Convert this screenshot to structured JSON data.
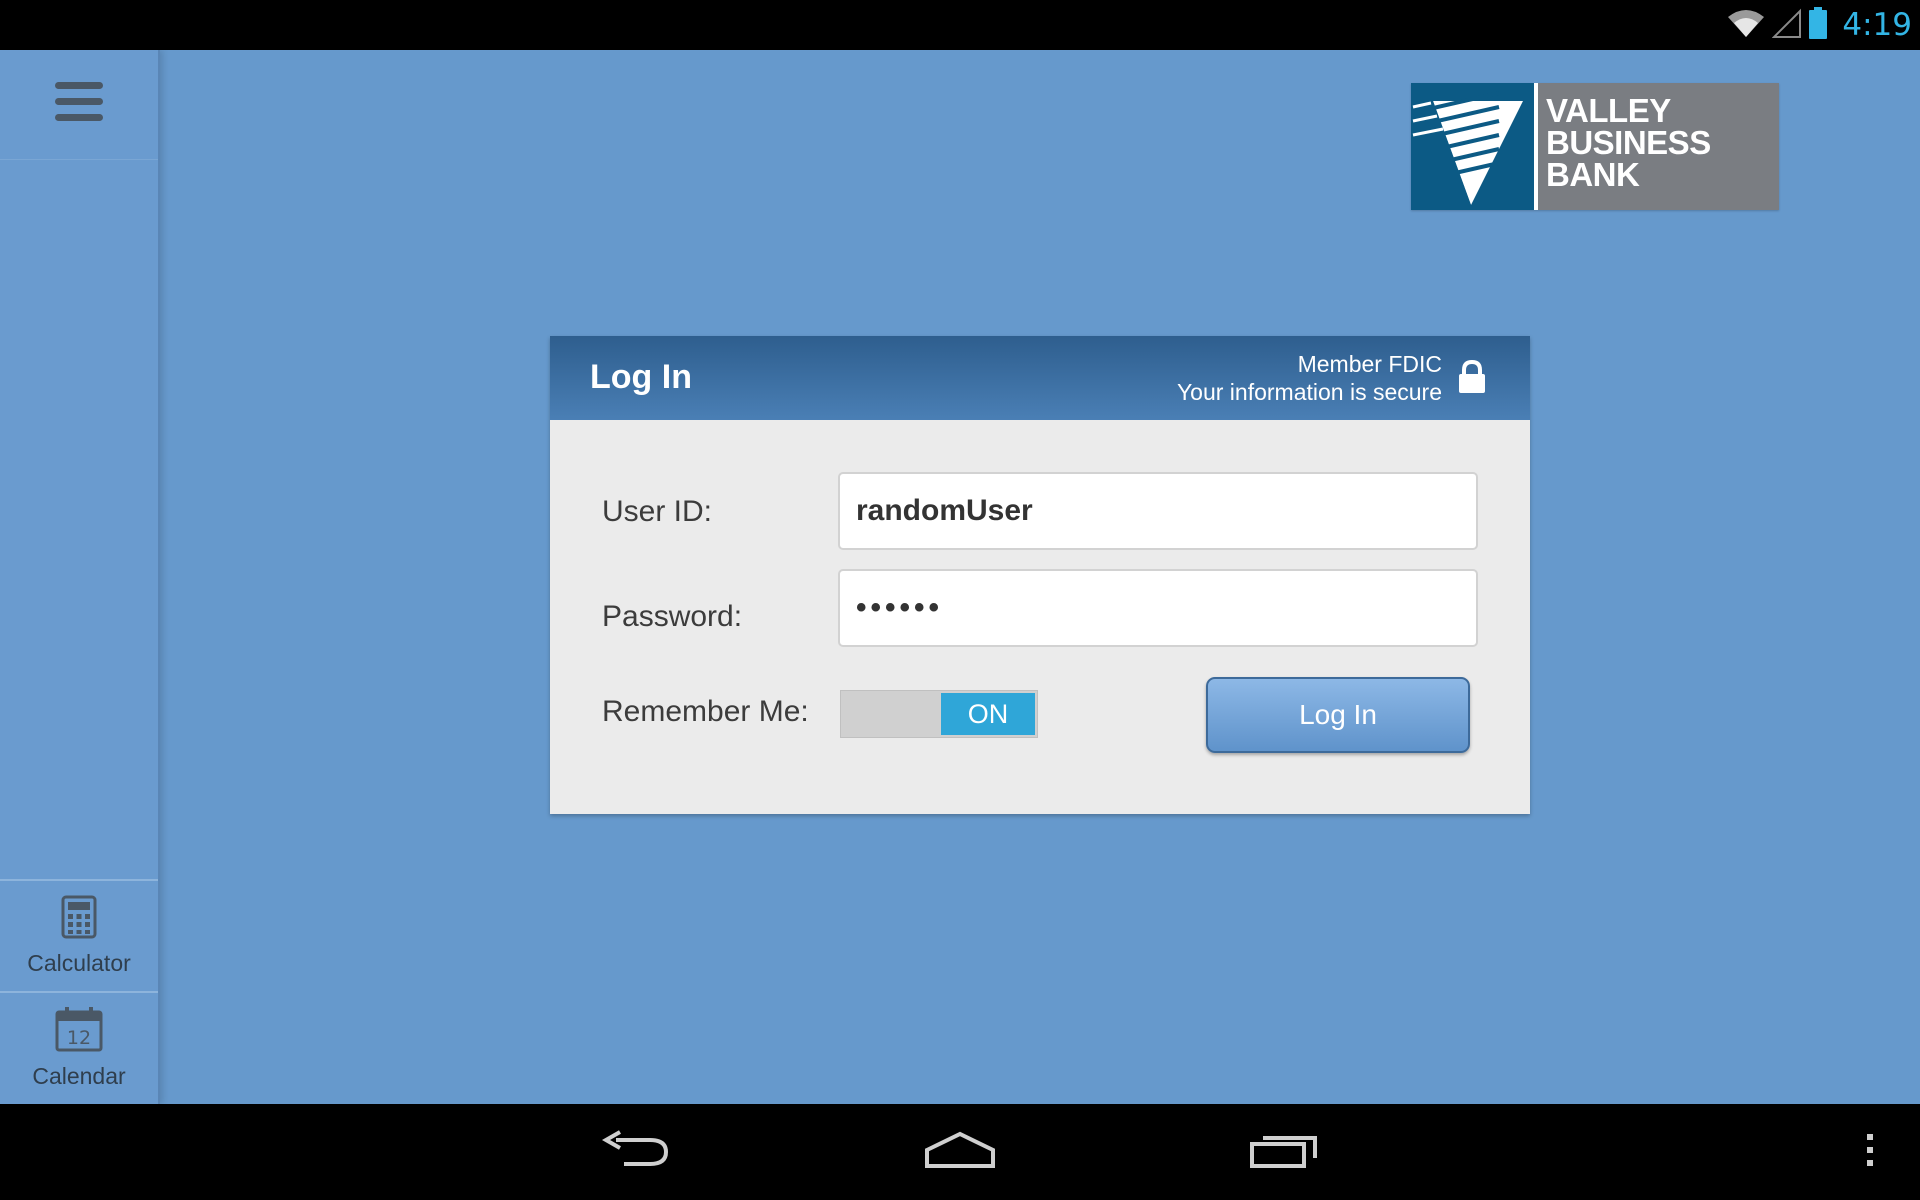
{
  "status_bar": {
    "time": "4:19",
    "icons": [
      "wifi-icon",
      "signal-icon",
      "battery-icon"
    ],
    "accent_color": "#33b5e5"
  },
  "sidebar": {
    "menu_icon": "hamburger-menu-icon",
    "tools": [
      {
        "label": "Calculator",
        "icon": "calculator-icon"
      },
      {
        "label": "Calendar",
        "icon": "calendar-icon",
        "icon_text": "12"
      }
    ]
  },
  "logo": {
    "lines": [
      "VALLEY",
      "BUSINESS",
      "BANK"
    ],
    "brand_color": "#0c5a85"
  },
  "login": {
    "title": "Log In",
    "secure_line1": "Member FDIC",
    "secure_line2": "Your information is secure",
    "user_label": "User ID:",
    "user_value": "randomUser",
    "password_label": "Password:",
    "password_value": "••••••",
    "remember_label": "Remember Me:",
    "remember_state": "ON",
    "submit_label": "Log In"
  },
  "nav_bar": {
    "buttons": [
      "back-icon",
      "home-icon",
      "recent-apps-icon",
      "overflow-menu-icon"
    ]
  }
}
